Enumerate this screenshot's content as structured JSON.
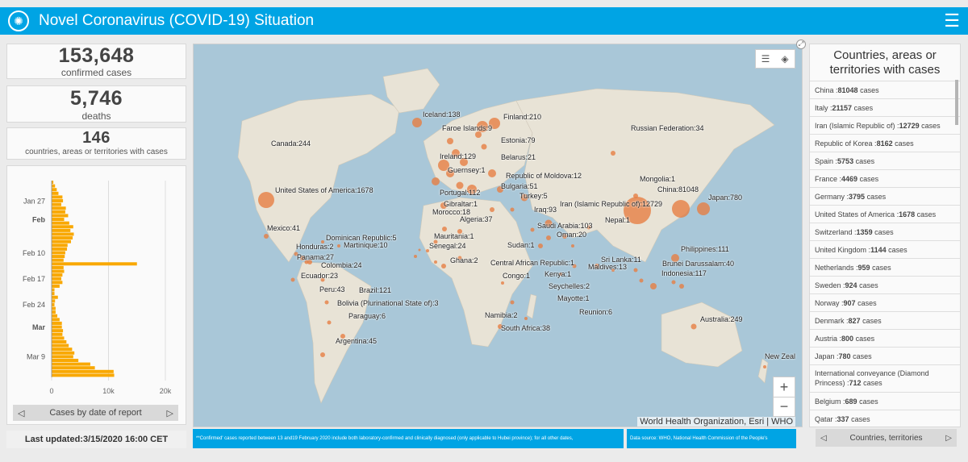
{
  "header": {
    "title": "Novel Coronavirus (COVID-19) Situation",
    "logo_icon": "who-logo-icon",
    "menu_icon": "hamburger-menu-icon"
  },
  "stats": {
    "confirmed": {
      "value": "153,648",
      "label": "confirmed cases"
    },
    "deaths": {
      "value": "5,746",
      "label": "deaths"
    },
    "countries": {
      "value": "146",
      "label": "countries, areas or territories with cases"
    }
  },
  "chart_data": {
    "type": "bar",
    "orientation": "horizontal",
    "title": "",
    "xlabel": "",
    "ylabel": "",
    "xlim": [
      0,
      20000
    ],
    "x_ticks": [
      "0",
      "10k",
      "20k"
    ],
    "y_ticks": [
      "Jan 27",
      "Feb",
      "Feb 10",
      "Feb 17",
      "Feb 24",
      "Mar",
      "Mar 9"
    ],
    "bar_color": "#f9a800",
    "categories": [
      "Jan 22",
      "Jan 23",
      "Jan 24",
      "Jan 25",
      "Jan 26",
      "Jan 27",
      "Jan 28",
      "Jan 29",
      "Jan 30",
      "Jan 31",
      "Feb 1",
      "Feb 2",
      "Feb 3",
      "Feb 4",
      "Feb 5",
      "Feb 6",
      "Feb 7",
      "Feb 8",
      "Feb 9",
      "Feb 10",
      "Feb 11",
      "Feb 12",
      "Feb 13",
      "Feb 14",
      "Feb 15",
      "Feb 16",
      "Feb 17",
      "Feb 18",
      "Feb 19",
      "Feb 20",
      "Feb 21",
      "Feb 22",
      "Feb 23",
      "Feb 24",
      "Feb 25",
      "Feb 26",
      "Feb 27",
      "Feb 28",
      "Feb 29",
      "Mar 1",
      "Mar 2",
      "Mar 3",
      "Mar 4",
      "Mar 5",
      "Mar 6",
      "Mar 7",
      "Mar 8",
      "Mar 9",
      "Mar 10",
      "Mar 11",
      "Mar 12",
      "Mar 13",
      "Mar 14"
    ],
    "values": [
      300,
      600,
      900,
      1200,
      1900,
      2000,
      1700,
      2500,
      2400,
      2900,
      2200,
      3100,
      3800,
      3300,
      3900,
      3700,
      3400,
      2800,
      2700,
      2400,
      2300,
      2100,
      15000,
      2100,
      2200,
      1900,
      1700,
      1900,
      1400,
      500,
      500,
      1100,
      600,
      500,
      700,
      700,
      1000,
      1400,
      1800,
      1800,
      2000,
      1900,
      2200,
      2600,
      3000,
      3600,
      4000,
      3800,
      4700,
      6800,
      7600,
      10900,
      11000
    ]
  },
  "chart_footer": {
    "label": "Cases by date of report",
    "prev_icon": "triangle-left-icon",
    "next_icon": "triangle-right-icon"
  },
  "last_updated": "Last updated:3/15/2020 16:00 CET",
  "map": {
    "attribution": "World Health Organization, Esri | WHO",
    "labels": [
      {
        "text": "Iceland:138"
      },
      {
        "text": "Finland:210"
      },
      {
        "text": "Faroe Islands:9"
      },
      {
        "text": "Russian Federation:34"
      },
      {
        "text": "Estonia:79"
      },
      {
        "text": "Canada:244"
      },
      {
        "text": "Ireland:129"
      },
      {
        "text": "Belarus:21"
      },
      {
        "text": "Guernsey:1"
      },
      {
        "text": "Republic of Moldova:12"
      },
      {
        "text": "Mongolia:1"
      },
      {
        "text": "United States of America:1678"
      },
      {
        "text": "Portugal:112"
      },
      {
        "text": "Bulgaria:51"
      },
      {
        "text": "China:81048"
      },
      {
        "text": "Turkey:5"
      },
      {
        "text": "Japan:780"
      },
      {
        "text": "Gibraltar:1"
      },
      {
        "text": "Iran (Islamic Republic of):12729"
      },
      {
        "text": "Morocco:18"
      },
      {
        "text": "Iraq:93"
      },
      {
        "text": "Algeria:37"
      },
      {
        "text": "Nepal:1"
      },
      {
        "text": "Mexico:41"
      },
      {
        "text": "Saudi Arabia:103"
      },
      {
        "text": "Dominican Republic:5"
      },
      {
        "text": "Mauritania:1"
      },
      {
        "text": "Oman:20"
      },
      {
        "text": "Honduras:2"
      },
      {
        "text": "Martinique:10"
      },
      {
        "text": "Senegal:24"
      },
      {
        "text": "Sudan:1"
      },
      {
        "text": "Philippines:111"
      },
      {
        "text": "Panama:27"
      },
      {
        "text": "Ghana:2"
      },
      {
        "text": "Sri Lanka:11"
      },
      {
        "text": "Colombia:24"
      },
      {
        "text": "Central African Republic:1"
      },
      {
        "text": "Maldives:13"
      },
      {
        "text": "Brunei Darussalam:40"
      },
      {
        "text": "Ecuador:23"
      },
      {
        "text": "Kenya:1"
      },
      {
        "text": "Indonesia:117"
      },
      {
        "text": "Congo:1"
      },
      {
        "text": "Peru:43"
      },
      {
        "text": "Brazil:121"
      },
      {
        "text": "Seychelles:2"
      },
      {
        "text": "Mayotte:1"
      },
      {
        "text": "Bolivia (Plurinational State of):3"
      },
      {
        "text": "Reunion:6"
      },
      {
        "text": "Paraguay:6"
      },
      {
        "text": "Namibia:2"
      },
      {
        "text": "Australia:249"
      },
      {
        "text": "South Africa:38"
      },
      {
        "text": "Argentina:45"
      },
      {
        "text": "New Zeal"
      }
    ],
    "zoom_in": "+",
    "zoom_out": "−",
    "tool_icons": [
      "legend-list-icon",
      "layers-icon"
    ],
    "note": "**Confirmed' cases reported between 13 and19 February 2020 include both laboratory-confirmed and clinically diagnosed (only  applicable to Hubei province); for all other dates,",
    "source": "Data source: WHO, National Health Commission of the People's"
  },
  "countries_list": {
    "title": "Countries, areas or territories with cases",
    "items": [
      {
        "name": "China",
        "count": "81048",
        "suffix": "cases"
      },
      {
        "name": "Italy",
        "count": "21157",
        "suffix": "cases"
      },
      {
        "name": "Iran (Islamic Republic of)",
        "count": "12729",
        "suffix": "cases"
      },
      {
        "name": "Republic of Korea",
        "count": "8162",
        "suffix": "cases"
      },
      {
        "name": "Spain",
        "count": "5753",
        "suffix": "cases"
      },
      {
        "name": "France",
        "count": "4469",
        "suffix": "cases"
      },
      {
        "name": "Germany",
        "count": "3795",
        "suffix": "cases"
      },
      {
        "name": "United States of America",
        "count": "1678",
        "suffix": "cases"
      },
      {
        "name": "Switzerland",
        "count": "1359",
        "suffix": "cases"
      },
      {
        "name": "United Kingdom",
        "count": "1144",
        "suffix": "cases"
      },
      {
        "name": "Netherlands",
        "count": "959",
        "suffix": "cases"
      },
      {
        "name": "Sweden",
        "count": "924",
        "suffix": "cases"
      },
      {
        "name": "Norway",
        "count": "907",
        "suffix": "cases"
      },
      {
        "name": "Denmark",
        "count": "827",
        "suffix": "cases"
      },
      {
        "name": "Austria",
        "count": "800",
        "suffix": "cases"
      },
      {
        "name": "Japan",
        "count": "780",
        "suffix": "cases"
      },
      {
        "name": "International conveyance (Diamond Princess)",
        "count": "712",
        "suffix": "cases"
      },
      {
        "name": "Belgium",
        "count": "689",
        "suffix": "cases"
      },
      {
        "name": "Qatar",
        "count": "337",
        "suffix": "cases"
      }
    ],
    "footer_label": "Countries, territories"
  }
}
